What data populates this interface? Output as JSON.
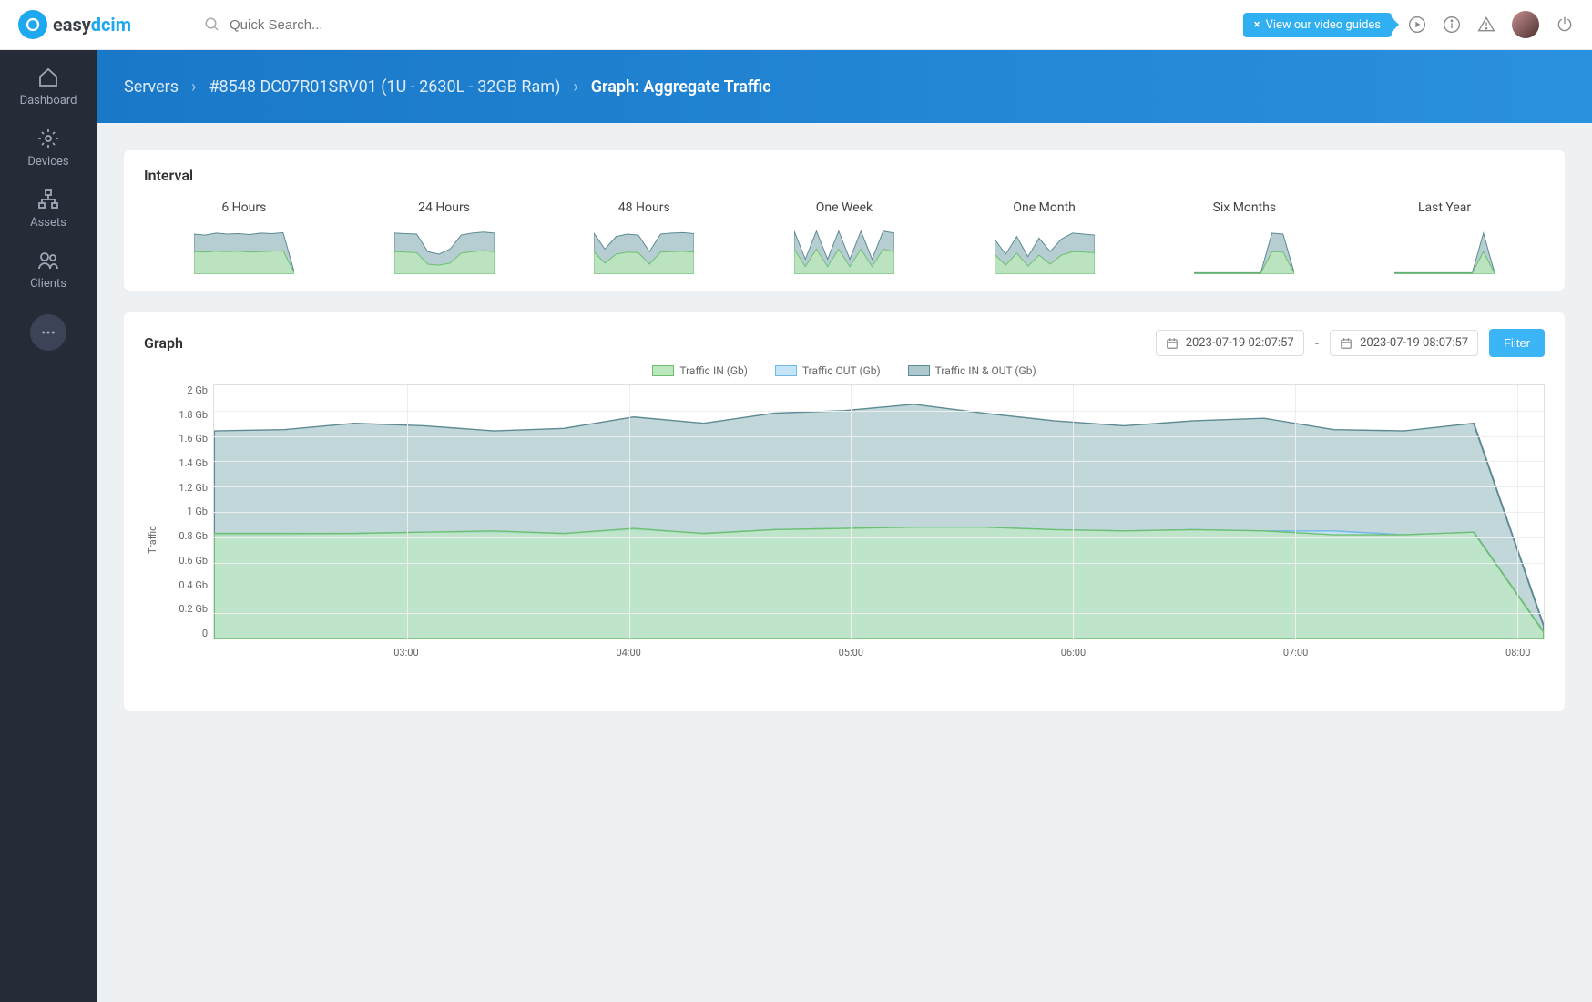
{
  "brand": {
    "name_a": "easy",
    "name_b": "dcim"
  },
  "search": {
    "placeholder": "Quick Search..."
  },
  "topbar": {
    "video_guides": "View our video guides"
  },
  "sidebar": {
    "items": [
      {
        "label": "Dashboard",
        "icon": "home"
      },
      {
        "label": "Devices",
        "icon": "gear"
      },
      {
        "label": "Assets",
        "icon": "sitemap"
      },
      {
        "label": "Clients",
        "icon": "users"
      }
    ]
  },
  "breadcrumb": {
    "root": "Servers",
    "item": "#8548 DC07R01SRV01 (1U - 2630L - 32GB Ram)",
    "active": "Graph: Aggregate Traffic"
  },
  "interval": {
    "title": "Interval",
    "options": [
      "6 Hours",
      "24 Hours",
      "48 Hours",
      "One Week",
      "One Month",
      "Six Months",
      "Last Year"
    ]
  },
  "graph": {
    "title": "Graph",
    "date_from": "2023-07-19 02:07:57",
    "date_to": "2023-07-19 08:07:57",
    "filter": "Filter",
    "legend": [
      "Traffic IN (Gb)",
      "Traffic OUT (Gb)",
      "Traffic IN & OUT (Gb)"
    ],
    "ylabel": "Traffic"
  },
  "chart_data": {
    "type": "area",
    "title": "Aggregate Traffic",
    "xlabel": "",
    "ylabel": "Traffic",
    "ylim": [
      0,
      2
    ],
    "y_ticks": [
      "2 Gb",
      "1.8 Gb",
      "1.6 Gb",
      "1.4 Gb",
      "1.2 Gb",
      "1 Gb",
      "0.8 Gb",
      "0.6 Gb",
      "0.4 Gb",
      "0.2 Gb",
      "0"
    ],
    "x_ticks": [
      "03:00",
      "04:00",
      "05:00",
      "06:00",
      "07:00",
      "08:00"
    ],
    "x": [
      "02:07",
      "02:20",
      "02:40",
      "03:00",
      "03:20",
      "03:40",
      "04:00",
      "04:20",
      "04:40",
      "05:00",
      "05:20",
      "05:40",
      "06:00",
      "06:20",
      "06:40",
      "07:00",
      "07:20",
      "07:40",
      "08:00",
      "08:07"
    ],
    "series": [
      {
        "name": "Traffic IN (Gb)",
        "color_stroke": "#6cc070",
        "color_fill": "#bce6be",
        "values": [
          0.83,
          0.83,
          0.83,
          0.84,
          0.85,
          0.83,
          0.87,
          0.83,
          0.86,
          0.87,
          0.88,
          0.88,
          0.86,
          0.85,
          0.86,
          0.85,
          0.82,
          0.82,
          0.84,
          0.05
        ]
      },
      {
        "name": "Traffic OUT (Gb)",
        "color_stroke": "#6fb8e8",
        "color_fill": "#c4e4f7",
        "values": [
          0.82,
          0.82,
          0.83,
          0.84,
          0.84,
          0.83,
          0.86,
          0.83,
          0.86,
          0.87,
          0.88,
          0.88,
          0.86,
          0.85,
          0.86,
          0.85,
          0.85,
          0.82,
          0.84,
          0.05
        ]
      },
      {
        "name": "Traffic IN & OUT (Gb)",
        "color_stroke": "#5e8a93",
        "color_fill": "#aec9cd",
        "values": [
          1.64,
          1.65,
          1.7,
          1.68,
          1.64,
          1.66,
          1.75,
          1.7,
          1.78,
          1.8,
          1.85,
          1.78,
          1.72,
          1.68,
          1.72,
          1.74,
          1.65,
          1.64,
          1.7,
          0.1
        ]
      }
    ],
    "colors": {
      "in_stroke": "#6cc070",
      "in_fill": "#bce6be",
      "out_stroke": "#6fb8e8",
      "out_fill": "#c4e4f7",
      "inout_stroke": "#5e8a93",
      "inout_fill": "#aec9cd"
    }
  }
}
